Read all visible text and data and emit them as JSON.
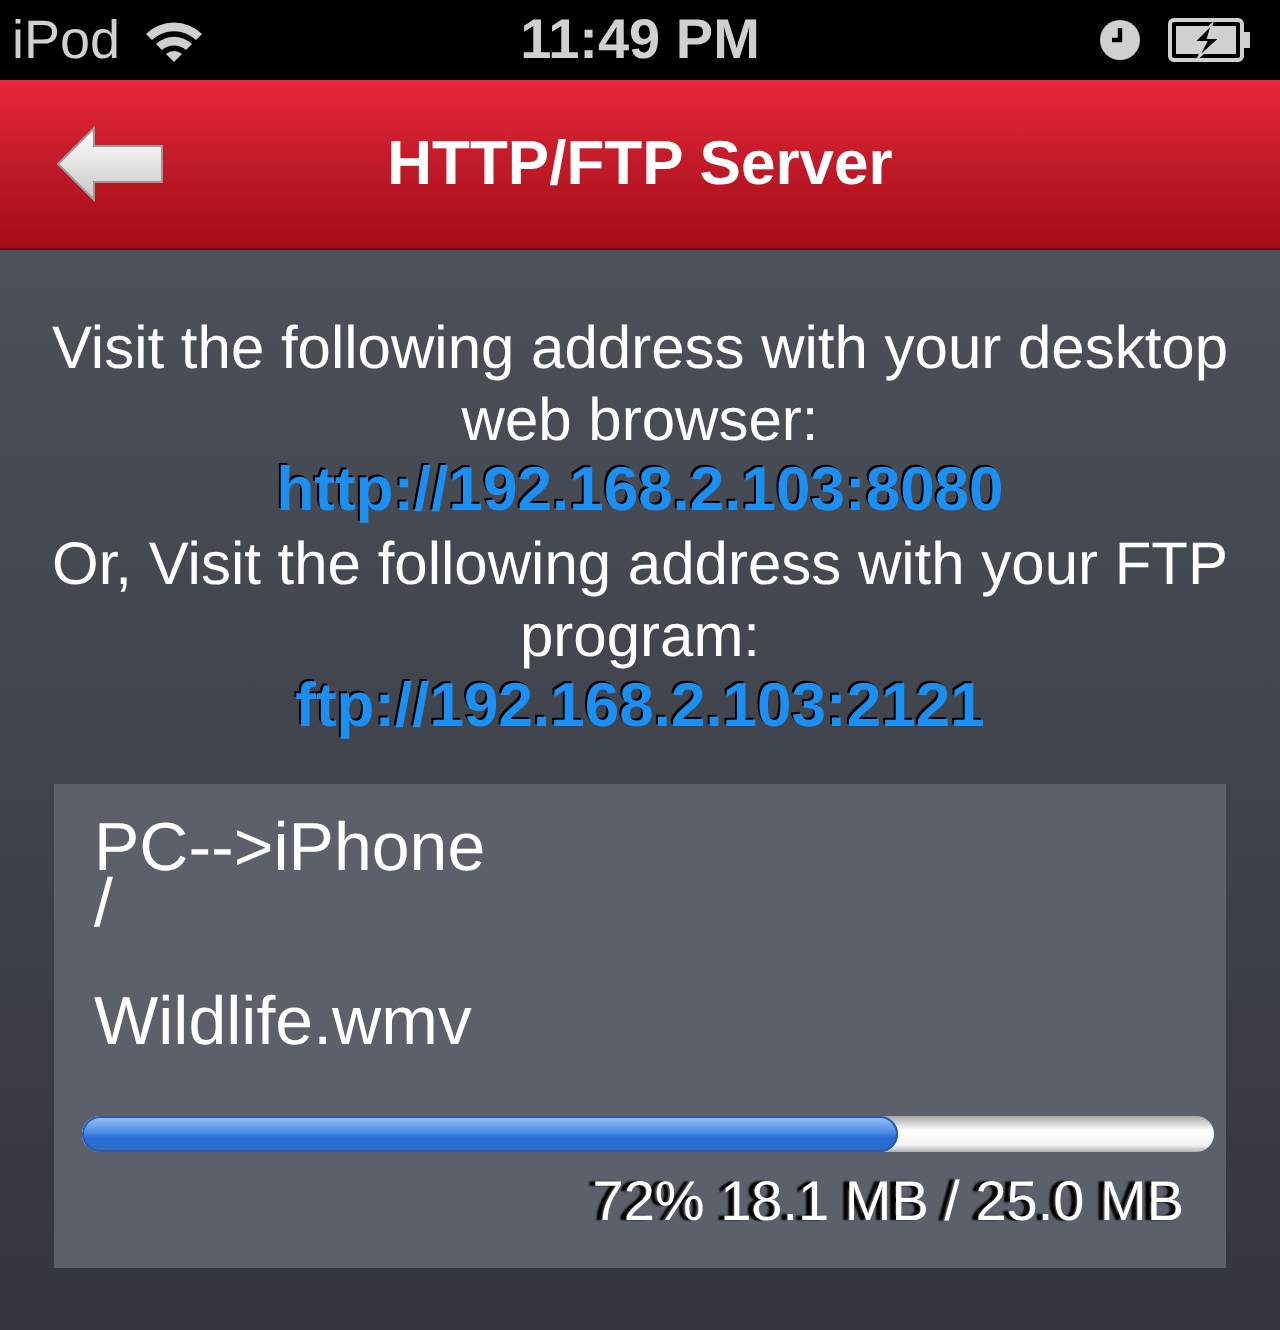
{
  "status_bar": {
    "carrier": "iPod",
    "time": "11:49 PM",
    "charging": true
  },
  "nav_bar": {
    "title": "HTTP/FTP Server"
  },
  "instructions": [
    {
      "kind": "text",
      "text": "Visit the following address with your desktop web browser:"
    },
    {
      "kind": "link",
      "text": "http://192.168.2.103:8080"
    },
    {
      "kind": "text",
      "text": "Or, Visit the following address with your FTP program:"
    },
    {
      "kind": "link",
      "text": "ftp://192.168.2.103:2121"
    }
  ],
  "transfer": {
    "direction": "PC-->iPhone",
    "path": "/",
    "file_name": "Wildlife.wmv",
    "level": 0.72,
    "progress_text": "72% 18.1 MB / 25.0 MB"
  }
}
